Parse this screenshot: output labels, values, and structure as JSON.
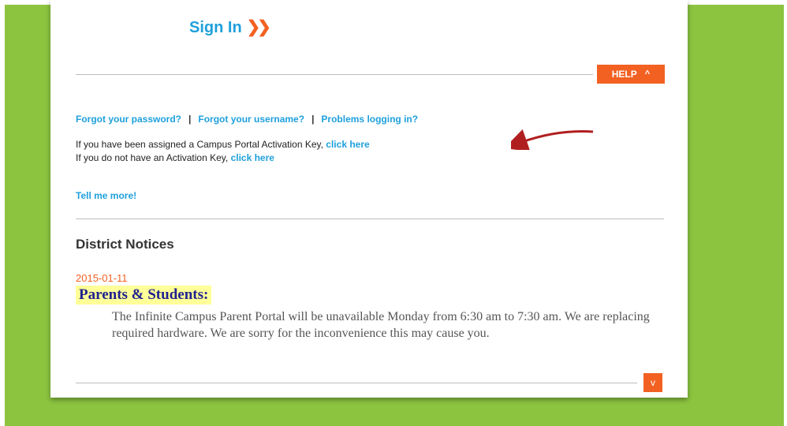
{
  "header": {
    "signin_label": "Sign In",
    "signin_chevrons": "❯❯"
  },
  "help": {
    "label": "HELP",
    "caret": "^"
  },
  "links": {
    "forgot_password": "Forgot your password?",
    "forgot_username": "Forgot your username?",
    "problems_logging": "Problems logging in?",
    "separator": "|"
  },
  "activation": {
    "line1_text": "If you have been assigned a Campus Portal Activation Key, ",
    "line1_link": "click here",
    "line2_text": "If you do not have an Activation Key, ",
    "line2_link": "click here"
  },
  "tell_more": "Tell me more!",
  "district": {
    "title": "District Notices",
    "notice": {
      "date": "2015-01-11",
      "heading": "Parents & Students:",
      "body": "The Infinite Campus Parent Portal will be unavailable Monday from 6:30 am to 7:30 am.  We are replacing required hardware.  We are sorry for the inconvenience this may cause you."
    }
  },
  "expand_icon": "v",
  "colors": {
    "background_green": "#8cc43f",
    "link_blue": "#1fa0dc",
    "accent_orange": "#f26122",
    "highlight_yellow": "#ffff99",
    "heading_navy": "#1f1f8f",
    "annotation_arrow": "#b01f1f"
  }
}
